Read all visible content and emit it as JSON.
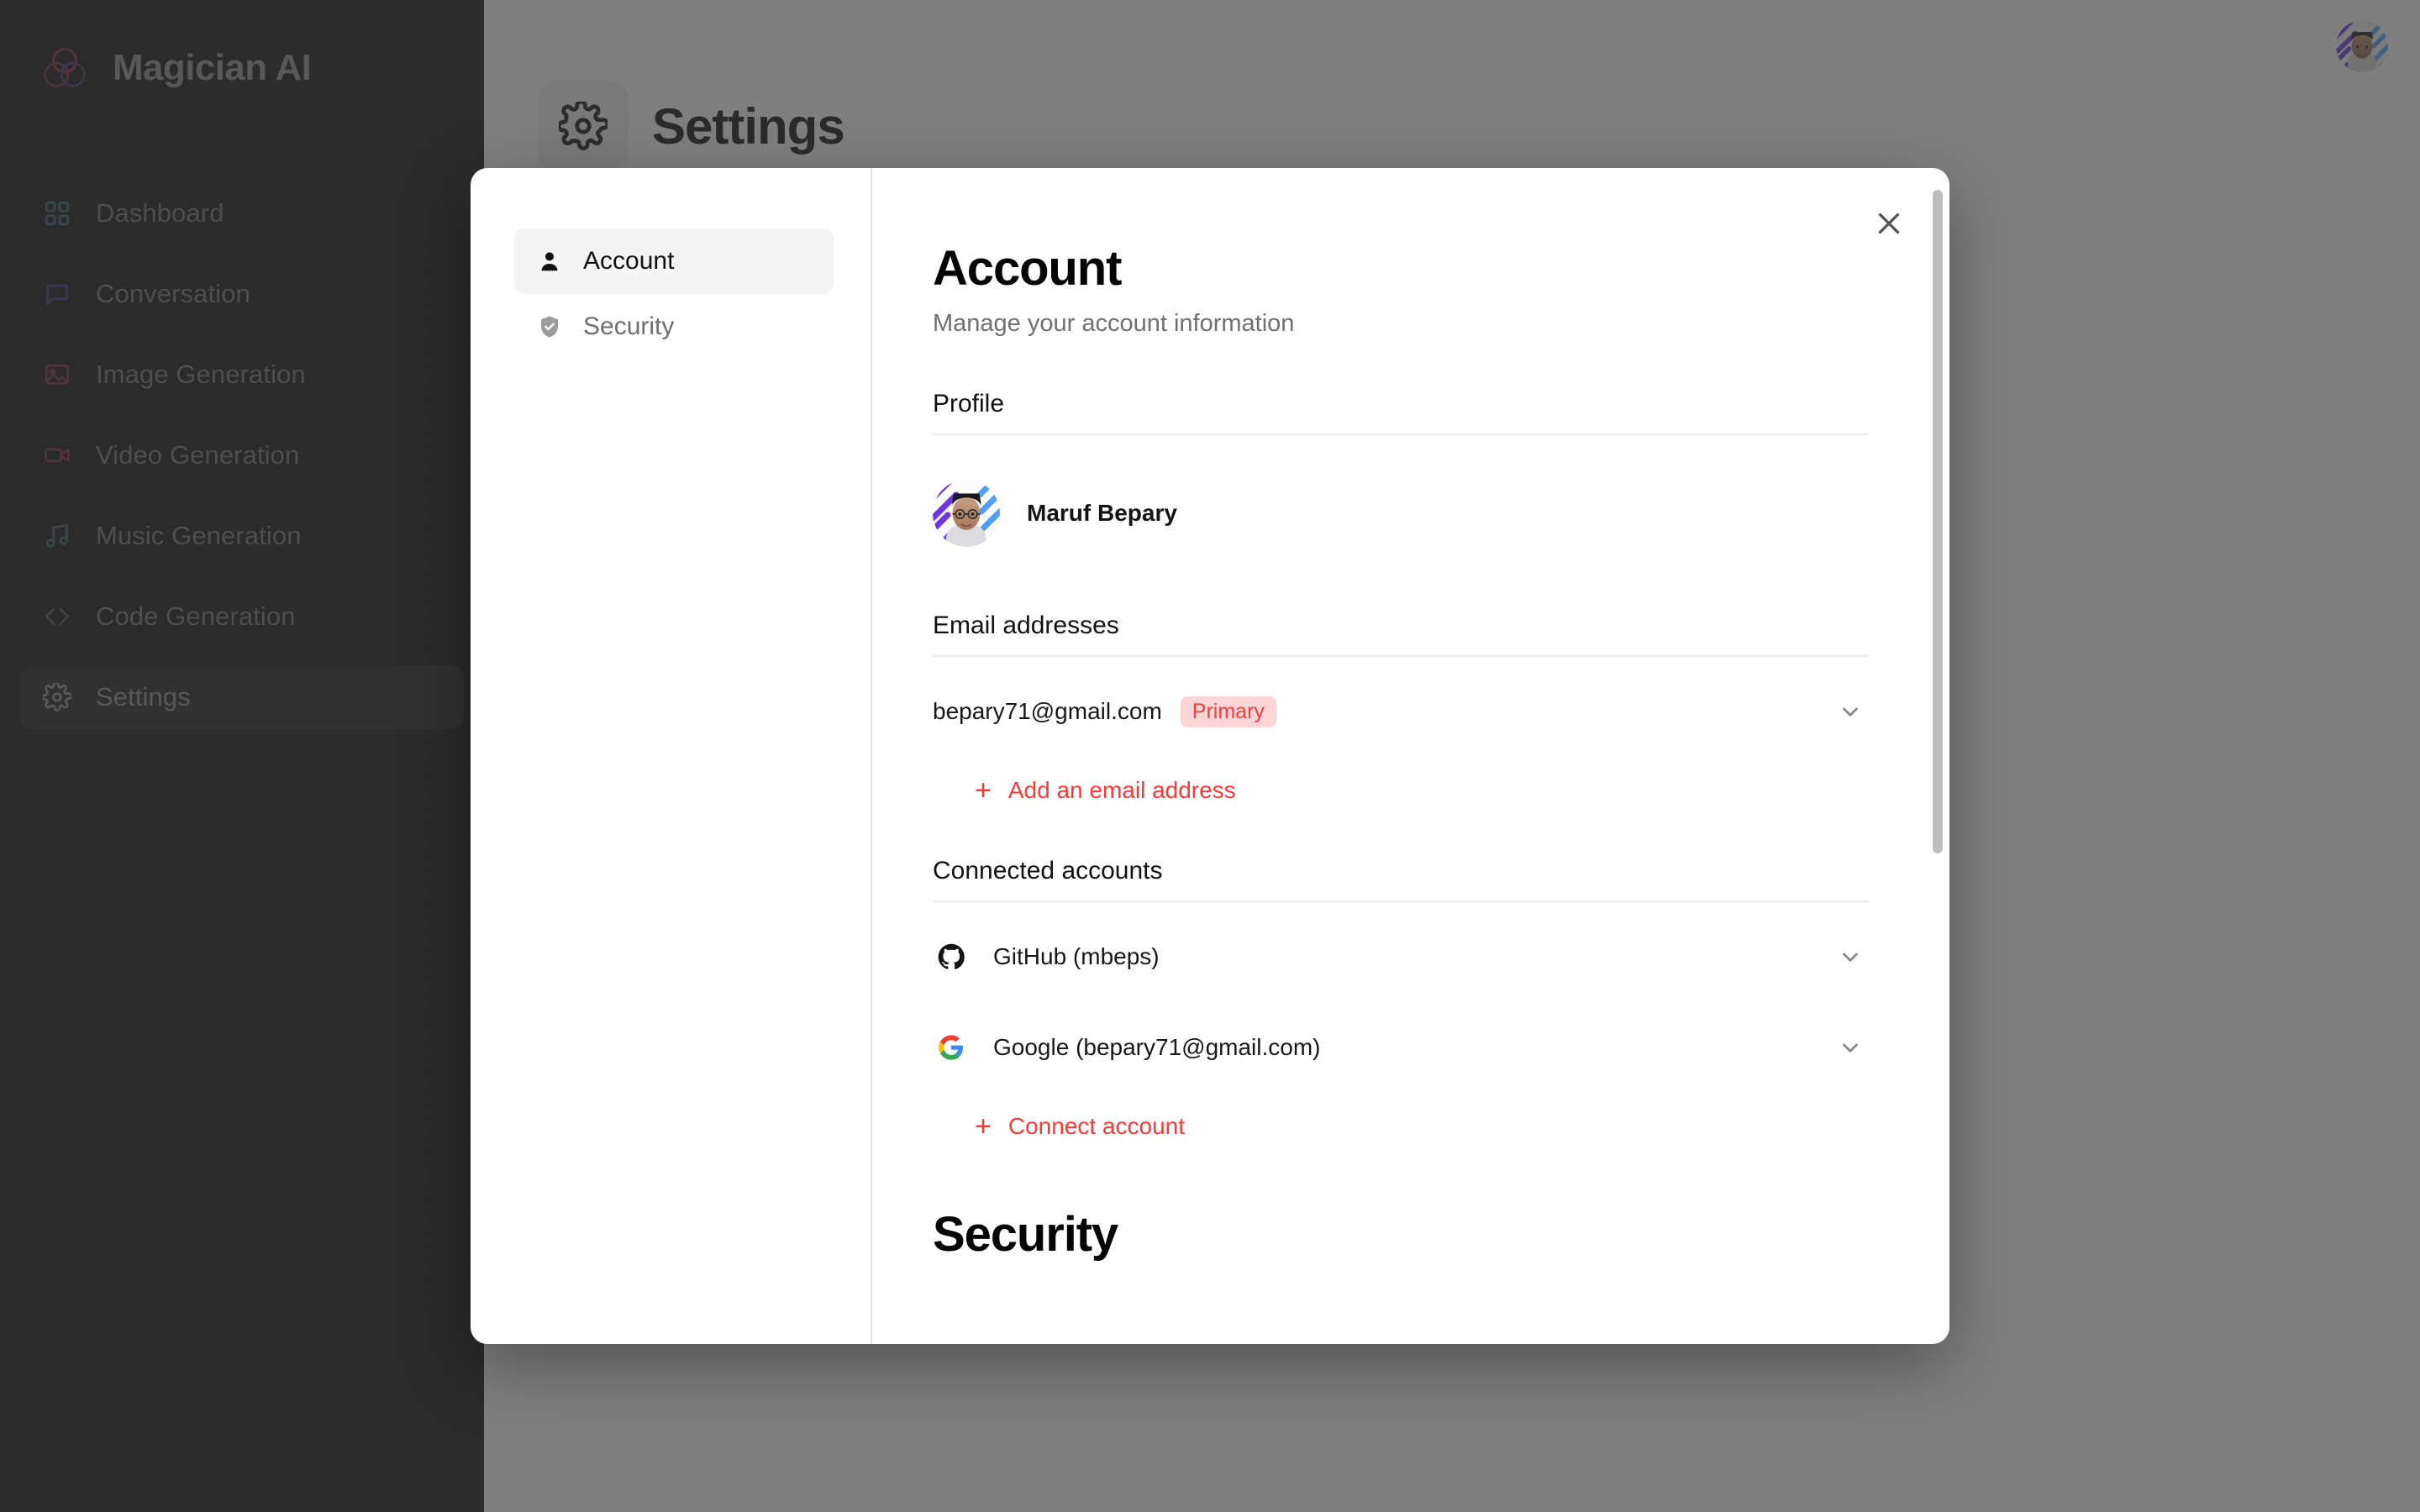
{
  "brand": {
    "name": "Magician AI",
    "logo_icon": "magician-logo-icon"
  },
  "sidebar": {
    "items": [
      {
        "label": "Dashboard",
        "icon": "grid-dashboard-icon",
        "color": "#2f5d6b",
        "active": false
      },
      {
        "label": "Conversation",
        "icon": "message-bubble-icon",
        "color": "#402a72",
        "active": false
      },
      {
        "label": "Image Generation",
        "icon": "image-icon",
        "color": "#6b2a33",
        "active": false
      },
      {
        "label": "Video Generation",
        "icon": "video-camera-icon",
        "color": "#7a2233",
        "active": false
      },
      {
        "label": "Music Generation",
        "icon": "music-note-icon",
        "color": "#2f5d6b",
        "active": false
      },
      {
        "label": "Code Generation",
        "icon": "code-brackets-icon",
        "color": "#4a4a4e",
        "active": false
      },
      {
        "label": "Settings",
        "icon": "gear-icon",
        "color": "#8d8d90",
        "active": true
      }
    ]
  },
  "page": {
    "title": "Settings",
    "title_icon": "gear-icon",
    "topbar_avatar_alt": "Maruf Bepary"
  },
  "modal": {
    "close_label": "×",
    "nav": {
      "items": [
        {
          "label": "Account",
          "icon": "person-icon",
          "active": true
        },
        {
          "label": "Security",
          "icon": "shield-check-icon",
          "active": false
        }
      ]
    },
    "account": {
      "heading": "Account",
      "subheading": "Manage your account information",
      "profile": {
        "section_title": "Profile",
        "name": "Maruf Bepary",
        "avatar_alt": "Maruf Bepary"
      },
      "emails": {
        "section_title": "Email addresses",
        "rows": [
          {
            "address": "bepary71@gmail.com",
            "badge": "Primary",
            "chevron_icon": "chevron-down-icon"
          }
        ],
        "add_label": "Add an email address",
        "add_icon": "plus-icon"
      },
      "connected": {
        "section_title": "Connected accounts",
        "rows": [
          {
            "label": "GitHub (mbeps)",
            "icon": "github-icon",
            "chevron_icon": "chevron-down-icon"
          },
          {
            "label": "Google (bepary71@gmail.com)",
            "icon": "google-icon",
            "chevron_icon": "chevron-down-icon"
          }
        ],
        "add_label": "Connect account",
        "add_icon": "plus-icon"
      },
      "security_heading": "Security"
    }
  },
  "colors": {
    "accent_red": "#f63b3b",
    "badge_bg": "#ffd5d5",
    "sidebar_bg": "#0b0b0c",
    "overlay": "rgba(60,60,60,0.66)",
    "modal_bg": "#ffffff"
  }
}
